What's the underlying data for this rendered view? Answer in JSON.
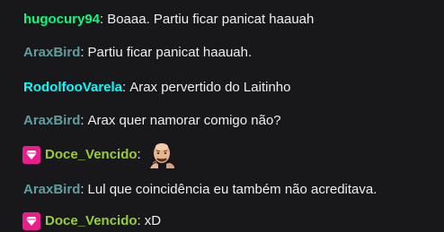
{
  "chat": {
    "messages": [
      {
        "username": "hugocury94",
        "color": "#00ff7f",
        "separator": ":",
        "text": "Boaaa. Partiu ficar panicat haauah"
      },
      {
        "username": "AraxBird",
        "color": "#5f9ea0",
        "separator": ":",
        "text": "Partiu ficar panicat haauah."
      },
      {
        "username": "RodolfooVarela",
        "color": "#00ffff",
        "separator": ":",
        "text": "Arax pervertido do Laitinho"
      },
      {
        "username": "AraxBird",
        "color": "#5f9ea0",
        "separator": ":",
        "text": "Arax quer namorar comigo não?"
      },
      {
        "username": "Doce_Vencido",
        "color": "#9acd32",
        "separator": ":",
        "text": "",
        "badge": "diamond-icon",
        "badge_color": "#e91e8c",
        "emote": "bald-man-emote"
      },
      {
        "username": "AraxBird",
        "color": "#5f9ea0",
        "separator": ":",
        "text": "Lul que coincidência eu também não acreditava."
      },
      {
        "username": "Doce_Vencido",
        "color": "#9acd32",
        "separator": ":",
        "text": "xD",
        "badge": "diamond-icon",
        "badge_color": "#e91e8c"
      }
    ]
  }
}
